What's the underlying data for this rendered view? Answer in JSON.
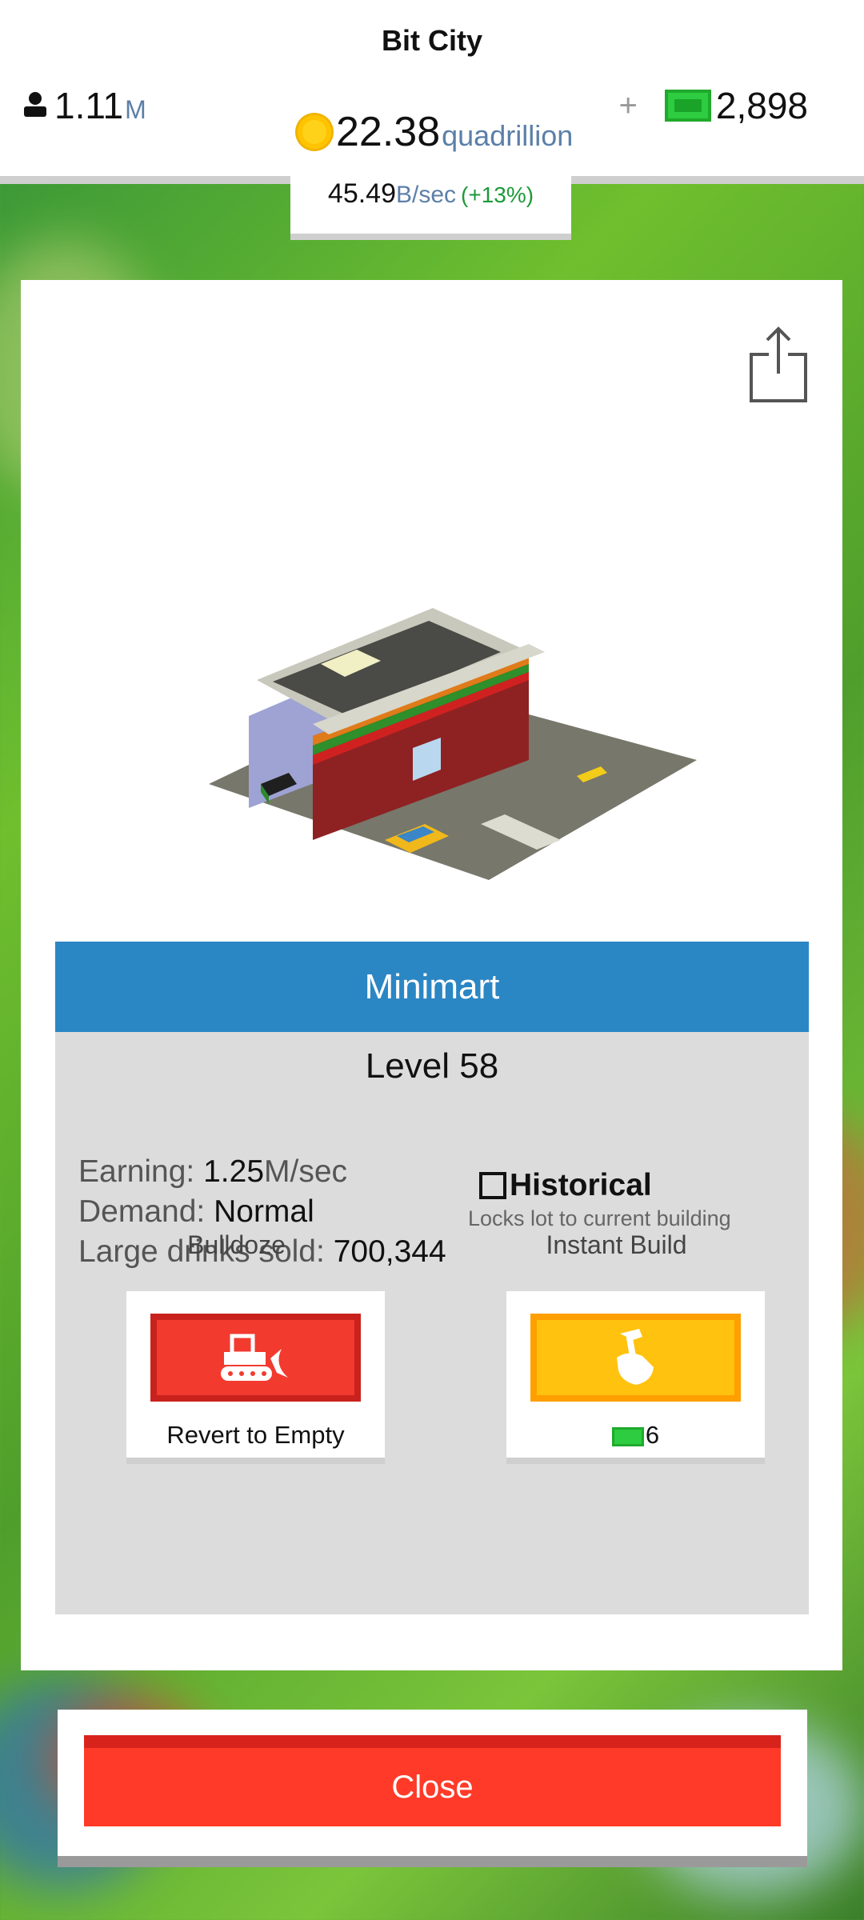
{
  "header": {
    "city_name": "Bit City",
    "population_value": "1.11",
    "population_unit": "M",
    "coins_value": "22.38",
    "coins_unit": "quadrillion",
    "cash_plus": "+",
    "cash_value": "2,898",
    "rate_value": "45.49",
    "rate_unit": "B/sec",
    "rate_change": "(+13%)"
  },
  "building": {
    "name": "Minimart",
    "level": "Level 58",
    "earning_label": "Earning:",
    "earning_value": "1.25",
    "earning_unit": "M/sec",
    "demand_label": "Demand:",
    "demand_value": "Normal",
    "stat_label": "Large drinks sold:",
    "stat_value": "700,344",
    "historical_label": "Historical",
    "historical_desc": "Locks lot to current building",
    "historical_checked": false
  },
  "actions": {
    "bulldoze_title": "Bulldoze",
    "bulldoze_caption": "Revert to Empty",
    "instant_title": "Instant Build",
    "instant_cost": "6"
  },
  "close_label": "Close",
  "icons": {
    "population": "person-icon",
    "coins": "coin-icon",
    "cash": "cash-icon",
    "share": "share-icon",
    "bulldozer": "bulldozer-icon",
    "build": "hammer-hand-icon"
  },
  "colors": {
    "accent_blue": "#2b86c4",
    "close_red": "#ff3a28",
    "bulldoze_red": "#f23a2f",
    "build_yellow": "#ffc20e",
    "cash_green": "#2ecc40"
  }
}
